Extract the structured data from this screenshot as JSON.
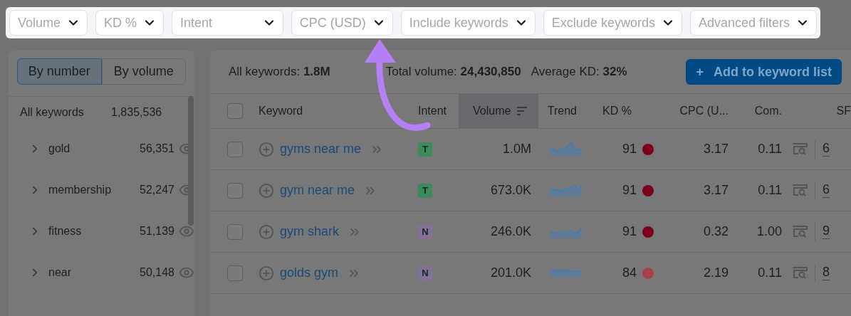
{
  "filters": [
    {
      "label": "Volume"
    },
    {
      "label": "KD %"
    },
    {
      "label": "Intent"
    },
    {
      "label": "CPC (USD)"
    },
    {
      "label": "Include keywords"
    },
    {
      "label": "Exclude keywords"
    },
    {
      "label": "Advanced filters"
    }
  ],
  "groups": {
    "modes": [
      {
        "label": "By number",
        "selected": true
      },
      {
        "label": "By volume",
        "selected": false
      }
    ],
    "total": {
      "label": "All keywords",
      "count": "1,835,536"
    },
    "items": [
      {
        "name": "gold",
        "count": "56,351"
      },
      {
        "name": "membership",
        "count": "52,247"
      },
      {
        "name": "fitness",
        "count": "51,139"
      },
      {
        "name": "near",
        "count": "50,148"
      }
    ]
  },
  "summary": [
    {
      "label": "All keywords:",
      "value": "1.8M"
    },
    {
      "label": "Total volume:",
      "value": "24,430,850"
    },
    {
      "label": "Average KD:",
      "value": "32%"
    }
  ],
  "add_button": {
    "icon": "+",
    "label": "Add to keyword list"
  },
  "table": {
    "all_checked": false,
    "columns": [
      {
        "label": "Keyword",
        "sorted": false
      },
      {
        "label": "Intent",
        "sorted": false
      },
      {
        "label": "Volume",
        "sorted": true
      },
      {
        "label": "Trend",
        "sorted": false
      },
      {
        "label": "KD %",
        "sorted": false
      },
      {
        "label": "CPC (U...",
        "sorted": false
      },
      {
        "label": "Com.",
        "sorted": false
      },
      {
        "label": "SF",
        "sorted": false
      }
    ],
    "rows": [
      {
        "checked": false,
        "keyword": "gyms near me",
        "intent": {
          "label": "T",
          "color": "#3d8a5c"
        },
        "volume": "1.0M",
        "kd": {
          "value": "91",
          "color": "#7a0019"
        },
        "cpc": "3.17",
        "com": "0.11",
        "sf": "6"
      },
      {
        "checked": false,
        "keyword": "gym near me",
        "intent": {
          "label": "T",
          "color": "#3d8a5c"
        },
        "volume": "673.0K",
        "kd": {
          "value": "91",
          "color": "#7a0019"
        },
        "cpc": "3.17",
        "com": "0.11",
        "sf": "6"
      },
      {
        "checked": false,
        "keyword": "gym shark",
        "intent": {
          "label": "N",
          "color": "#85709a"
        },
        "volume": "246.0K",
        "kd": {
          "value": "91",
          "color": "#7a0019"
        },
        "cpc": "0.32",
        "com": "1.00",
        "sf": "9"
      },
      {
        "checked": false,
        "keyword": "golds gym",
        "intent": {
          "label": "N",
          "color": "#85709a"
        },
        "volume": "201.0K",
        "kd": {
          "value": "84",
          "color": "#a8404c"
        },
        "cpc": "2.19",
        "com": "0.11",
        "sf": "8"
      }
    ]
  }
}
